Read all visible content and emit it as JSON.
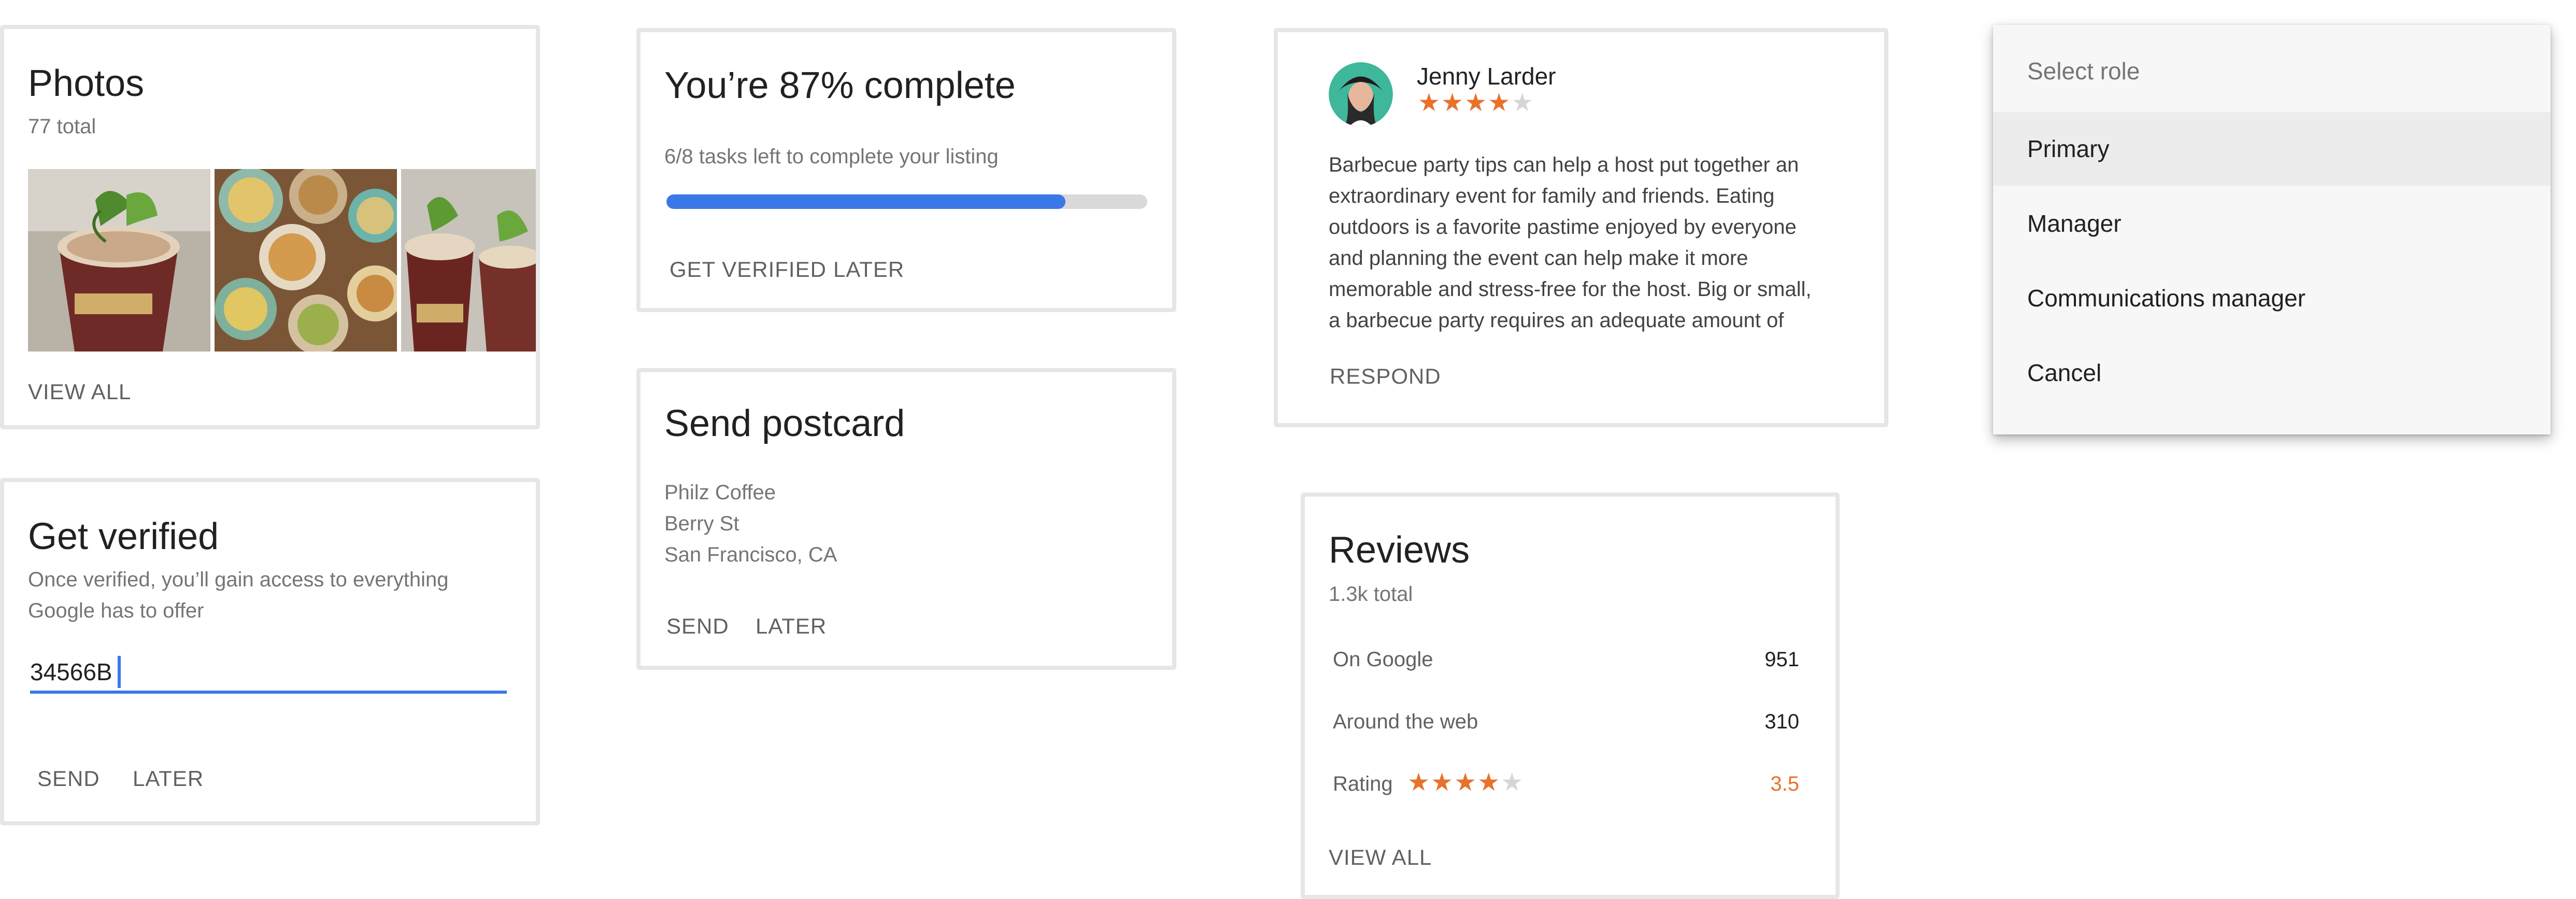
{
  "photos_card": {
    "title": "Photos",
    "subtitle": "77 total",
    "action": "VIEW ALL",
    "photos": [
      "iced-coffee-cup-photo",
      "food-bowls-photo",
      "coffee-cups-photo"
    ]
  },
  "verify_card": {
    "title": "Get verified",
    "description_line1": "Once verified, you’ll gain access to everything",
    "description_line2": "Google has to offer",
    "input_value": "34566B",
    "send": "SEND",
    "later": "LATER"
  },
  "progress_card": {
    "title": "You’re 87% complete",
    "tasks_text": "6/8 tasks left to complete your listing",
    "progress": 0.83,
    "get_verified": "GET VERIFIED",
    "later": "LATER"
  },
  "postcard_card": {
    "title": "Send postcard",
    "address": [
      "Philz Coffee",
      "Berry St",
      "San Francisco, CA"
    ],
    "send": "SEND",
    "later": "LATER"
  },
  "review_card": {
    "reviewer": "Jenny Larder",
    "rating": 4,
    "max_rating": 5,
    "text_lines": [
      "Barbecue party tips can help a host put together an",
      "extraordinary event for family and friends. Eating",
      "outdoors is a favorite pastime enjoyed by everyone",
      "and planning the event can help make it more",
      "memorable and stress-free for the host. Big or small,",
      "a barbecue party requires an adequate amount of"
    ],
    "respond": "RESPOND"
  },
  "reviews_card": {
    "title": "Reviews",
    "subtitle": "1.3k total",
    "rows": [
      {
        "label": "On Google",
        "value": "951"
      },
      {
        "label": "Around the web",
        "value": "310"
      }
    ],
    "rating_label": "Rating",
    "rating_stars": 4,
    "rating_value": "3.5",
    "action": "VIEW ALL"
  },
  "role_menu": {
    "title": "Select role",
    "items": [
      "Primary",
      "Manager",
      "Communications manager",
      "Cancel"
    ]
  },
  "colors": {
    "accent_blue": "#3b78e7",
    "star_orange": "#e8722c",
    "rating_orange": "#e8722c"
  }
}
